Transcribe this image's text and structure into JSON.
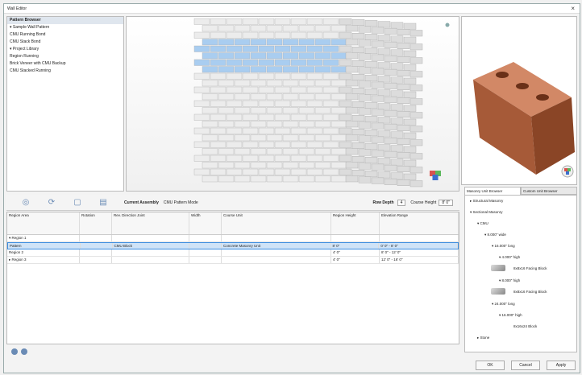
{
  "window": {
    "title": "Wall Editor",
    "close_glyph": "×"
  },
  "left_tree": {
    "items": [
      {
        "label": "Pattern Browser",
        "header": true
      },
      {
        "label": "▾  Sample Wall Pattern",
        "header": false
      },
      {
        "label": "     CMU Running Bond",
        "header": false
      },
      {
        "label": "     CMU Stack Bond",
        "header": false
      },
      {
        "label": "▾  Project Library",
        "header": false
      },
      {
        "label": "     Region Running",
        "header": false
      },
      {
        "label": "     Brick Veneer with CMU Backup",
        "header": false
      },
      {
        "label": "     CMU Stacked Running",
        "header": false
      }
    ]
  },
  "toolbar": {
    "icons": [
      "add-region-icon",
      "refresh-icon",
      "copy-icon",
      "delete-icon"
    ],
    "current_assembly_label": "Current Assembly",
    "current_assembly_value": "CMU Pattern Mode",
    "row_height_label": "Row Depth",
    "row_height_value": "4",
    "course_height_label": "Course Height",
    "course_height_value": "8' 0\""
  },
  "grid": {
    "columns": [
      "Region Area",
      "Rotation",
      "Rev. Direction Joint",
      "Width",
      "Course Unit",
      "Region Height",
      "Elevation Range"
    ],
    "rows": [
      {
        "cells": [
          "▾ Region 1",
          "",
          "",
          "",
          "",
          "",
          ""
        ],
        "selected": false
      },
      {
        "cells": [
          "    Pattern",
          "",
          "CMU Block",
          "",
          "Concrete Masonry Unit",
          "8' 0\"",
          "0' 0\" - 8' 0\""
        ],
        "selected": true
      },
      {
        "cells": [
          "    Region 2",
          "",
          "",
          "",
          "",
          "4' 0\"",
          "8' 0\" - 12' 0\""
        ],
        "selected": false
      },
      {
        "cells": [
          "▸ Region 3",
          "",
          "",
          "",
          "",
          "4' 0\"",
          "12' 0\" - 16' 0\""
        ],
        "selected": false
      }
    ]
  },
  "right_tabs": [
    "Masonry Unit Browser",
    "Custom Unit Browser"
  ],
  "right_tree": [
    {
      "label": "▸  Structural Masonry",
      "indent": 0
    },
    {
      "label": "▾  Sectional Masonry",
      "indent": 0
    },
    {
      "label": "▾  CMU",
      "indent": 1
    },
    {
      "label": "▾  8.000\" wide",
      "indent": 2
    },
    {
      "label": "▾  16.000\" long",
      "indent": 3
    },
    {
      "label": "▾  4.000\" high",
      "indent": 4
    },
    {
      "label": "8x8x16 Facing Block",
      "indent": 6,
      "thumb": true
    },
    {
      "label": "▾  8.000\" high",
      "indent": 4
    },
    {
      "label": "8x8x16 Facing Block",
      "indent": 6,
      "thumb": true
    },
    {
      "label": "▾  24.000\" long",
      "indent": 3
    },
    {
      "label": "▾  16.000\" high",
      "indent": 4
    },
    {
      "label": "8x16x24 Block",
      "indent": 6,
      "thumb": false
    },
    {
      "label": "▸  Stone",
      "indent": 1
    }
  ],
  "buttons": {
    "ok": "OK",
    "cancel": "Cancel",
    "apply": "Apply"
  },
  "colors": {
    "selection": "#cfe3f7",
    "brick": "#b86a45",
    "highlight_course": "#a9cdf0"
  }
}
